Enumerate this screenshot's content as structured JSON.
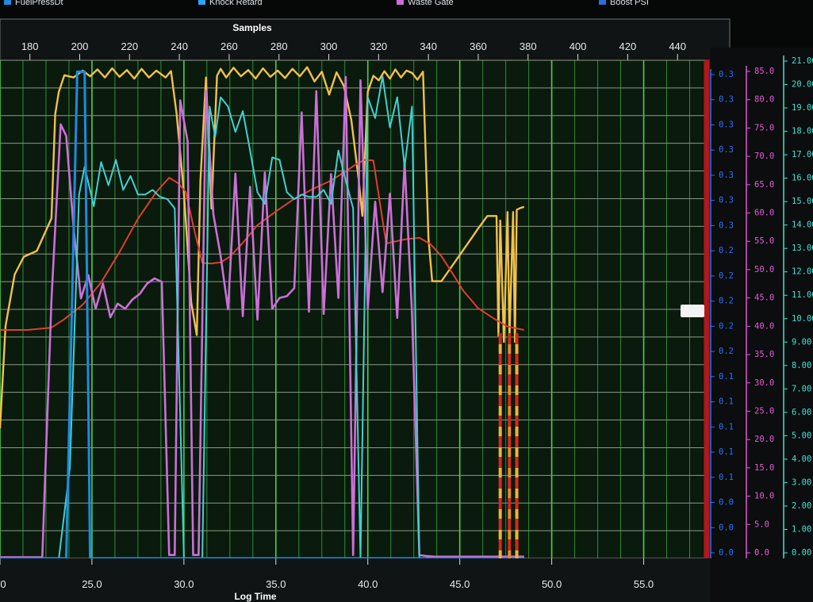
{
  "legend": [
    {
      "label": "FuelPressDt",
      "color": "#1d8be0"
    },
    {
      "label": "Knock Retard",
      "color": "#27a7ff"
    },
    {
      "label": "Waste Gate",
      "color": "#cc6fd8"
    },
    {
      "label": "Boost PSI",
      "color": "#2b6fd6"
    }
  ],
  "chart_data": {
    "type": "line",
    "top_axis": {
      "title": "Samples",
      "ticks": [
        200,
        220,
        240,
        260,
        280,
        300,
        320,
        340,
        360,
        380,
        400,
        420,
        440
      ],
      "tick_labels": [
        "180",
        "200",
        "220",
        "240",
        "260",
        "280",
        "300",
        "320",
        "340",
        "360",
        "380",
        "400",
        "420",
        "440"
      ]
    },
    "bottom_axis": {
      "title": "Log Time",
      "ticks": [
        25.0,
        30.0,
        35.0,
        40.0,
        45.0,
        50.0,
        55.0
      ],
      "tick_labels": [
        "0",
        "25.0",
        "30.0",
        "35.0",
        "40.0",
        "45.0",
        "50.0",
        "55.0"
      ]
    },
    "axis_range": {
      "x_time": [
        20.0,
        58.6
      ],
      "x_samples": [
        168.0,
        453.0
      ]
    },
    "right_axes": [
      {
        "name": "blue-axis",
        "color": "#2a73ff",
        "tick_labels": [
          "0.3",
          "0.3",
          "0.3",
          "0.3",
          "0.3",
          "0.3",
          "0.3",
          "0.2",
          "0.2",
          "0.2",
          "0.2",
          "0.2",
          "0.1",
          "0.1",
          "0.1",
          "0.1",
          "0.1",
          "0.0",
          "0.0",
          "0.0"
        ]
      },
      {
        "name": "magenta-axis",
        "color": "#e85ad8",
        "tick_labels": [
          "85.0",
          "80.0",
          "75.0",
          "70.0",
          "65.0",
          "60.0",
          "55.0",
          "50.0",
          "45.0",
          "40.0",
          "35.0",
          "30.0",
          "25.0",
          "20.0",
          "15.0",
          "10.0",
          "5.0",
          "0.0"
        ]
      },
      {
        "name": "cyan-axis",
        "color": "#41e3d6",
        "tick_labels": [
          "21.00",
          "20.00",
          "19.00",
          "18.00",
          "17.00",
          "16.00",
          "15.00",
          "14.00",
          "13.00",
          "12.00",
          "11.00",
          "10.00",
          "9.00",
          "8.00",
          "7.00",
          "6.00",
          "5.00",
          "4.00",
          "3.00",
          "2.00",
          "1.00",
          "0.00"
        ]
      }
    ],
    "series": [
      {
        "color": "#f2c14a",
        "x": [
          20.0,
          20.3,
          20.8,
          21.3,
          22.0,
          22.8,
          23.0,
          23.2,
          23.5,
          24.0,
          24.5,
          24.9,
          25.3,
          25.7,
          26.1,
          26.5,
          26.9,
          27.3,
          27.7,
          28.1,
          28.5,
          29.0,
          29.3,
          29.6,
          30.0,
          30.4,
          30.7,
          30.9,
          31.2,
          31.5,
          31.8,
          32.0,
          32.3,
          32.7,
          33.1,
          33.5,
          33.9,
          34.3,
          34.7,
          35.1,
          35.5,
          35.9,
          36.3,
          36.7,
          37.1,
          37.5,
          37.9,
          38.3,
          38.7,
          39.1,
          39.5,
          39.7,
          40.0,
          40.3,
          40.6,
          40.9,
          41.2,
          41.5,
          41.8,
          42.1,
          42.4,
          42.7,
          43.0,
          43.3,
          43.5,
          44.0,
          44.5,
          45.0,
          45.5,
          46.0,
          46.5,
          47.0,
          47.1,
          47.2,
          47.4,
          47.6,
          47.7,
          47.9,
          48.0,
          48.1,
          48.3,
          48.5
        ],
        "y": [
          22.7,
          40.6,
          49.6,
          52.7,
          53.7,
          59.4,
          77.6,
          81.5,
          84.4,
          84.0,
          85.2,
          84.2,
          85.4,
          84.0,
          85.6,
          84.1,
          85.3,
          83.8,
          85.5,
          84.0,
          85.2,
          84.0,
          85.1,
          77.7,
          63.8,
          44.7,
          39.0,
          66.0,
          84.0,
          61.1,
          84.3,
          85.5,
          84.0,
          85.7,
          84.2,
          85.3,
          83.8,
          85.6,
          84.1,
          85.2,
          83.9,
          85.5,
          84.2,
          85.8,
          83.3,
          85.0,
          81.0,
          84.9,
          82.5,
          76.6,
          66.3,
          59.8,
          81.5,
          84.3,
          83.5,
          85.1,
          83.8,
          85.4,
          84.0,
          85.2,
          84.8,
          83.6,
          85.0,
          55.9,
          48.4,
          48.4,
          50.7,
          53.0,
          55.3,
          57.6,
          59.8,
          59.8,
          38.9,
          59.0,
          37.8,
          60.5,
          38.3,
          60.5,
          37.8,
          60.9,
          61.2,
          61.4
        ]
      },
      {
        "color": "#e0402a",
        "x": [
          20.0,
          21.5,
          22.8,
          23.5,
          24.5,
          25.5,
          26.5,
          27.5,
          28.5,
          29.2,
          29.7,
          30.1,
          30.5,
          31.0,
          31.5,
          32.0,
          32.5,
          33.2,
          34.0,
          35.0,
          36.0,
          37.0,
          38.0,
          38.8,
          39.3,
          39.8,
          40.3,
          41.0,
          42.0,
          42.8,
          43.4,
          44.0,
          44.6,
          45.2,
          46.0,
          46.8,
          47.6,
          48.5
        ],
        "y": [
          39.9,
          39.9,
          40.3,
          41.8,
          44.3,
          48.2,
          53.5,
          59.3,
          64.0,
          66.5,
          65.5,
          64.0,
          58.2,
          51.6,
          51.5,
          51.7,
          52.7,
          55.1,
          58.2,
          60.6,
          62.8,
          64.5,
          66.0,
          67.6,
          68.7,
          69.6,
          69.5,
          55.0,
          55.7,
          56.0,
          54.9,
          52.8,
          49.8,
          46.7,
          43.7,
          42.0,
          40.5,
          39.9
        ]
      },
      {
        "color": "#cc6fd8",
        "x": [
          20.0,
          22.3,
          22.8,
          23.3,
          23.6,
          24.0,
          24.4,
          24.8,
          25.2,
          25.6,
          26.0,
          26.4,
          26.8,
          27.2,
          27.6,
          28.0,
          28.4,
          28.8,
          29.2,
          29.5,
          29.8,
          30.2,
          30.5,
          30.8,
          31.2,
          31.6,
          32.0,
          32.4,
          32.8,
          33.2,
          33.6,
          34.0,
          34.4,
          34.8,
          35.2,
          35.6,
          36.0,
          36.4,
          36.8,
          37.2,
          37.6,
          38.0,
          38.4,
          38.8,
          39.2,
          39.6,
          40.0,
          40.4,
          40.8,
          41.2,
          41.6,
          42.0,
          42.4,
          42.8,
          43.2,
          43.6,
          44.0,
          45.0,
          46.0,
          47.0,
          48.0,
          48.5
        ],
        "y": [
          0.2,
          0.2,
          45.2,
          75.8,
          73.8,
          57.8,
          45.4,
          49.5,
          43.6,
          48.0,
          42.1,
          44.5,
          43.6,
          45.2,
          46.2,
          48.0,
          48.9,
          48.3,
          0.6,
          0.6,
          80.0,
          72.9,
          0.6,
          0.6,
          81.7,
          60.1,
          52.8,
          43.5,
          67.2,
          42.3,
          64.9,
          41.7,
          67.4,
          43.6,
          45.5,
          45.8,
          47.2,
          77.9,
          43.1,
          81.6,
          42.7,
          67.1,
          45.5,
          84.1,
          0.6,
          83.5,
          43.6,
          62.3,
          46.5,
          63.7,
          42.0,
          69.3,
          42.9,
          0.6,
          0.4,
          0.3,
          0.3,
          0.3,
          0.3,
          0.3,
          0.3,
          0.3
        ]
      },
      {
        "color": "#3fd2d0",
        "x": [
          22.5,
          23.2,
          23.8,
          24.3,
          24.6,
          25.1,
          25.5,
          25.9,
          26.3,
          26.7,
          27.1,
          27.5,
          27.9,
          28.3,
          28.7,
          29.1,
          29.5,
          30.0,
          30.5,
          31.0,
          31.4,
          31.7,
          32.0,
          32.4,
          32.8,
          33.2,
          33.6,
          34.0,
          34.4,
          34.8,
          35.2,
          35.6,
          36.0,
          36.4,
          36.8,
          37.2,
          37.6,
          38.0,
          38.4,
          38.8,
          39.2,
          39.6,
          40.0,
          40.4,
          40.8,
          41.2,
          41.6,
          42.0,
          42.4,
          42.8,
          43.1,
          43.4,
          44.0,
          45.0,
          46.0,
          47.0,
          48.0,
          48.5
        ],
        "y": [
          0.0,
          0.0,
          3.9,
          15.7,
          16.9,
          15.2,
          17.1,
          16.1,
          17.2,
          15.9,
          16.5,
          15.7,
          15.7,
          15.9,
          15.6,
          15.5,
          15.1,
          0.0,
          0.0,
          0.0,
          19.5,
          18.2,
          19.9,
          19.5,
          18.4,
          19.3,
          17.6,
          15.8,
          15.3,
          17.3,
          17.2,
          15.8,
          15.5,
          15.7,
          15.6,
          15.6,
          15.9,
          15.3,
          17.6,
          16.3,
          15.1,
          0.0,
          19.9,
          19.0,
          20.8,
          18.6,
          19.9,
          16.9,
          19.5,
          0.0,
          0.0,
          0.0,
          0.0,
          0.0,
          0.0,
          0.0,
          0.0,
          0.0
        ]
      },
      {
        "color": "#1d8be0",
        "x": [
          20.0,
          23.6,
          24.2,
          24.4,
          24.6,
          24.9,
          25.2,
          25.4,
          30.0,
          35.0,
          40.0,
          45.0,
          48.5
        ],
        "y": [
          0.0,
          0.0,
          0.3,
          0.3,
          0.3,
          0.0,
          0.0,
          0.0,
          0.0,
          0.0,
          0.0,
          0.0,
          0.0
        ]
      }
    ]
  }
}
